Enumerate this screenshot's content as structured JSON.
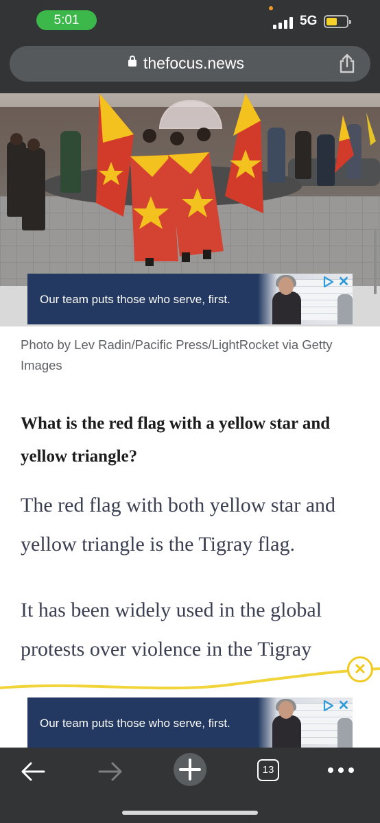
{
  "status_bar": {
    "time": "5:01",
    "network": "5G",
    "battery_level": 0.55
  },
  "browser": {
    "url": "thefocus.news",
    "open_tabs": "13"
  },
  "hero_image": {
    "caption": "Photo by Lev Radin/Pacific Press/LightRocket via Getty Images"
  },
  "ads": {
    "top_banner": {
      "text": "Our team puts those who serve, first."
    },
    "bottom_banner": {
      "text": "Our team puts those who serve, first."
    }
  },
  "article": {
    "question": "What is the red flag with a yellow star and yellow triangle?",
    "answer": "The red flag with both yellow star and yellow triangle is the Tigray flag.",
    "paragraph2": "It has been widely used in the global protests over violence in the Tigray"
  },
  "icons": {
    "lock": "lock-icon",
    "share": "share-icon",
    "close": "close-icon",
    "back": "back-arrow-icon",
    "forward": "forward-arrow-icon",
    "new_tab": "plus-icon",
    "more": "more-dots-icon"
  },
  "colors": {
    "browser_chrome": "#323436",
    "ad_background": "#233961",
    "flag_red": "#d23a2a",
    "flag_yellow": "#f4c21f",
    "dismiss_yellow": "#f1c91e"
  }
}
